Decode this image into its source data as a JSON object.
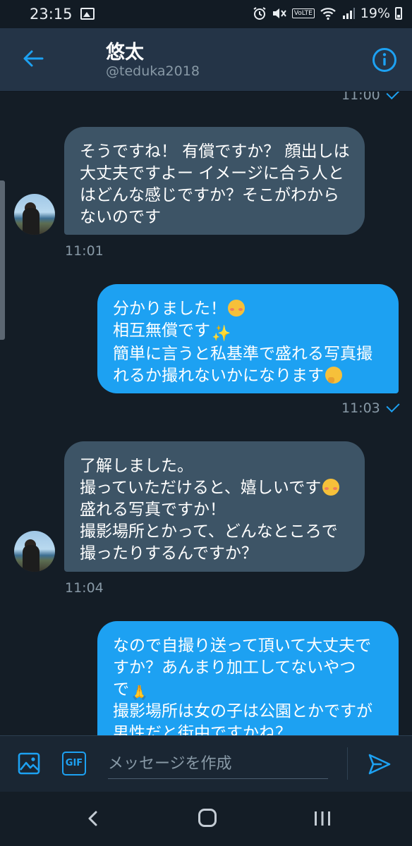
{
  "status_bar": {
    "time": "23:15",
    "battery": "19%",
    "volte": "VoLTE",
    "icons": [
      "gallery-icon",
      "alarm-icon",
      "mute-icon",
      "volte-icon",
      "wifi-icon",
      "signal-icon",
      "battery-icon"
    ]
  },
  "header": {
    "title": "悠太",
    "subtitle": "@teduka2018",
    "back_icon": "back-arrow-icon",
    "info_icon": "info-icon"
  },
  "messages": [
    {
      "direction": "out",
      "time": "11:00",
      "partial": true
    },
    {
      "direction": "in",
      "lines": [
        "そうですね！ 有償ですか？ 顔出しは",
        "大丈夫ですよー イメージに合う人と",
        "はどんな感じですか？そこがわから",
        "ないのです"
      ],
      "time": "11:01"
    },
    {
      "direction": "out",
      "lines": [
        "分かりました！",
        "相互無償です",
        "簡単に言うと私基準で盛れる写真撮",
        "れるか撮れないかになります"
      ],
      "emojis": [
        "smiling-blush-emoji",
        "sparkles-emoji",
        "thinking-face-emoji"
      ],
      "time": "11:03"
    },
    {
      "direction": "in",
      "lines": [
        "了解しました。",
        "撮っていただけると、嬉しいです",
        "盛れる写真ですか！",
        "撮影場所とかって、どんなところで",
        "撮ったりするんですか？"
      ],
      "emojis": [
        "smiling-face-emoji"
      ],
      "time": "11:04"
    },
    {
      "direction": "out",
      "lines": [
        "なので自撮り送って頂いて大丈夫で",
        "すか？あんまり加工してないやつ",
        "で",
        "撮影場所は女の子は公園とかですが",
        "男性だと街中ですかね？"
      ],
      "emojis": [
        "folded-hands-emoji"
      ]
    }
  ],
  "composer": {
    "placeholder": "メッセージを作成",
    "gif_label": "GIF",
    "media_icon": "image-icon",
    "send_icon": "send-icon"
  },
  "nav": {
    "icons": [
      "nav-back-icon",
      "nav-home-icon",
      "nav-recents-icon"
    ]
  },
  "colors": {
    "background": "#141d26",
    "header": "#243447",
    "incoming_bubble": "#3d5466",
    "outgoing_bubble": "#1da1f2",
    "accent": "#1da1f2",
    "muted_text": "#8899a6"
  }
}
